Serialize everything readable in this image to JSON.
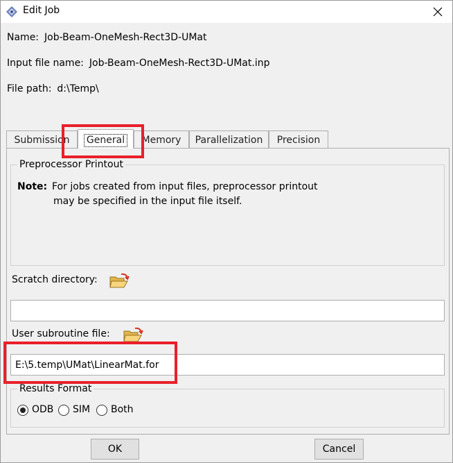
{
  "window": {
    "title": "Edit Job",
    "app_icon": "abaqus-icon",
    "close_icon": "close-icon"
  },
  "info": {
    "name_label": "Name:",
    "name_value": "Job-Beam-OneMesh-Rect3D-UMat",
    "input_label": "Input file name:",
    "input_value": "Job-Beam-OneMesh-Rect3D-UMat.inp",
    "path_label": "File path:",
    "path_value": "d:\\Temp\\"
  },
  "tabs": [
    {
      "label": "Submission"
    },
    {
      "label": "General",
      "active": true
    },
    {
      "label": "Memory"
    },
    {
      "label": "Parallelization"
    },
    {
      "label": "Precision"
    }
  ],
  "general": {
    "preprocessor": {
      "title": "Preprocessor Printout",
      "note_label": "Note:",
      "note_line1": "For jobs created from input files, preprocessor printout",
      "note_line2": "may be specified in the input file itself."
    },
    "scratch": {
      "label": "Scratch directory:",
      "value": "",
      "icon": "folder-open-icon"
    },
    "subroutine": {
      "label": "User subroutine file:",
      "value": "E:\\5.temp\\UMat\\LinearMat.for",
      "icon": "folder-open-icon"
    },
    "results": {
      "title": "Results Format",
      "options": [
        {
          "label": "ODB",
          "checked": true
        },
        {
          "label": "SIM",
          "checked": false
        },
        {
          "label": "Both",
          "checked": false
        }
      ]
    }
  },
  "buttons": {
    "ok": "OK",
    "cancel": "Cancel"
  },
  "colors": {
    "highlight": "#e8202a",
    "background": "#f0f0f0"
  }
}
